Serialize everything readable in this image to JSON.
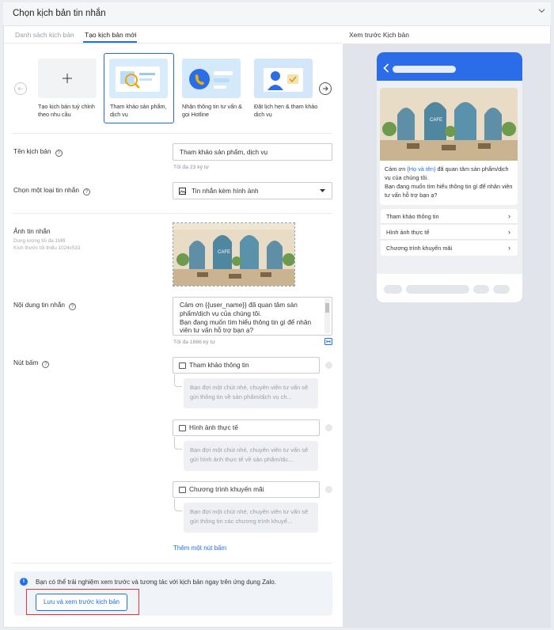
{
  "header": {
    "title": "Chọn kịch bản tin nhắn"
  },
  "tabs": {
    "list": "Danh sách kịch bản",
    "new": "Tạo kịch bản mới"
  },
  "preview": {
    "title": "Xem trước Kịch bản",
    "greeting_prefix": "Cảm ơn ",
    "name_placeholder": "{Họ và tên}",
    "greeting_suffix": " đã quan tâm sản phẩm/dịch vụ của chúng tôi.",
    "question": "Bạn đang muốn tìm hiểu thông tin gì để nhân viên tư vấn hỗ trợ bạn ạ?",
    "options": [
      "Tham khảo thông tin",
      "Hình ảnh thực tế",
      "Chương trình khuyến mãi"
    ]
  },
  "templates": [
    {
      "label": "Tạo kịch bản tuỳ chỉnh theo nhu cầu",
      "icon": "plus-icon"
    },
    {
      "label": "Tham khảo sản phẩm, dịch vụ",
      "icon": "search-doc-icon",
      "selected": true
    },
    {
      "label": "Nhận thông tin tư vấn & gọi Hotline",
      "icon": "phone-icon"
    },
    {
      "label": "Đặt lịch hẹn & tham khảo dịch vụ",
      "icon": "person-card-icon"
    }
  ],
  "form": {
    "name_label": "Tên kịch bản",
    "name_value": "Tham khảo sản phẩm, dịch vụ",
    "name_hint": "Tối đa 23 ký tự",
    "type_label": "Chọn một loại tin nhắn",
    "type_value": "Tin nhắn kèm hình ảnh",
    "image_label": "Ảnh tin nhắn",
    "image_hint1": "Dung lượng tối đa 1MB",
    "image_hint2": "Kích thước tối thiểu 1024x533",
    "content_label": "Nội dung tin nhắn",
    "content_value": "Cảm ơn {{user_name}} đã quan tâm sản phẩm/dịch vụ của chúng tôi.\nBạn đang muốn tìm hiểu thông tin gì để nhân viên tư vấn hỗ trợ bạn ạ?",
    "content_hint": "Tối đa 1866 ký tự",
    "buttons_label": "Nút bấm",
    "buttons": [
      {
        "label": "Tham khảo thông tin",
        "reply": "Bạn đợi một chút nhé, chuyên viên tư vấn sẽ gửi thông tin về sản phẩm/dịch vụ ch..."
      },
      {
        "label": "Hình ảnh thực tế",
        "reply": "Bạn đợi một chút nhé, chuyên viên tư vấn sẽ gửi hình ảnh thực tế về sản phẩm/dịc..."
      },
      {
        "label": "Chương trình khuyến mãi",
        "reply": "Bạn đợi một chút nhé, chuyên viên tư vấn sẽ gửi thông tin các chương trình khuyế..."
      }
    ],
    "add_button": "Thêm một nút bấm"
  },
  "footer": {
    "info": "Bạn có thể trải nghiệm xem trước và tương tác với kịch bản ngay trên ứng dụng Zalo.",
    "save_button": "Lưu và xem trước kịch bản"
  },
  "colors": {
    "accent": "#1f6ff2",
    "highlight_box": "#e53935",
    "phone_header": "#2b6de8"
  }
}
